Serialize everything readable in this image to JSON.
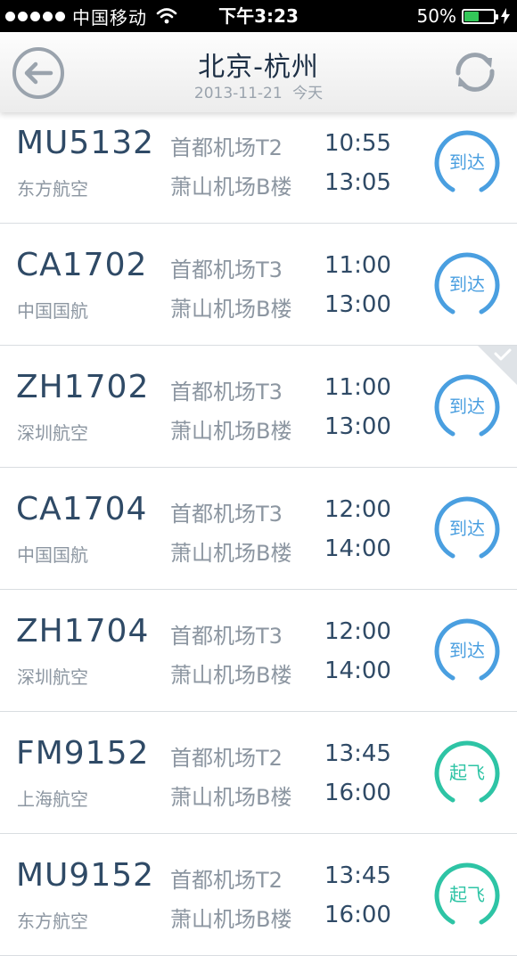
{
  "status_bar": {
    "carrier": "中国移动",
    "time": "下午3:23",
    "battery": "50%",
    "battery_level": 0.5
  },
  "header": {
    "title": "北京-杭州",
    "date": "2013-11-21",
    "day": "今天",
    "back_icon": "arrow-left-circle-icon",
    "refresh_icon": "refresh-icon"
  },
  "colors": {
    "arrived": "#4a9fe0",
    "departed": "#2ec4a5",
    "accent_dark": "#2f4a66"
  },
  "flights": [
    {
      "flight_no": "MU5132",
      "airline": "东方航空",
      "dep_airport": "首都机场T2",
      "arr_airport": "萧山机场B楼",
      "dep_time": "10:55",
      "arr_time": "13:05",
      "status": "到达",
      "status_key": "arrived",
      "selected": false
    },
    {
      "flight_no": "CA1702",
      "airline": "中国国航",
      "dep_airport": "首都机场T3",
      "arr_airport": "萧山机场B楼",
      "dep_time": "11:00",
      "arr_time": "13:00",
      "status": "到达",
      "status_key": "arrived",
      "selected": false
    },
    {
      "flight_no": "ZH1702",
      "airline": "深圳航空",
      "dep_airport": "首都机场T3",
      "arr_airport": "萧山机场B楼",
      "dep_time": "11:00",
      "arr_time": "13:00",
      "status": "到达",
      "status_key": "arrived",
      "selected": true
    },
    {
      "flight_no": "CA1704",
      "airline": "中国国航",
      "dep_airport": "首都机场T3",
      "arr_airport": "萧山机场B楼",
      "dep_time": "12:00",
      "arr_time": "14:00",
      "status": "到达",
      "status_key": "arrived",
      "selected": false
    },
    {
      "flight_no": "ZH1704",
      "airline": "深圳航空",
      "dep_airport": "首都机场T3",
      "arr_airport": "萧山机场B楼",
      "dep_time": "12:00",
      "arr_time": "14:00",
      "status": "到达",
      "status_key": "arrived",
      "selected": false
    },
    {
      "flight_no": "FM9152",
      "airline": "上海航空",
      "dep_airport": "首都机场T2",
      "arr_airport": "萧山机场B楼",
      "dep_time": "13:45",
      "arr_time": "16:00",
      "status": "起飞",
      "status_key": "departed",
      "selected": false
    },
    {
      "flight_no": "MU9152",
      "airline": "东方航空",
      "dep_airport": "首都机场T2",
      "arr_airport": "萧山机场B楼",
      "dep_time": "13:45",
      "arr_time": "16:00",
      "status": "起飞",
      "status_key": "departed",
      "selected": false
    }
  ]
}
